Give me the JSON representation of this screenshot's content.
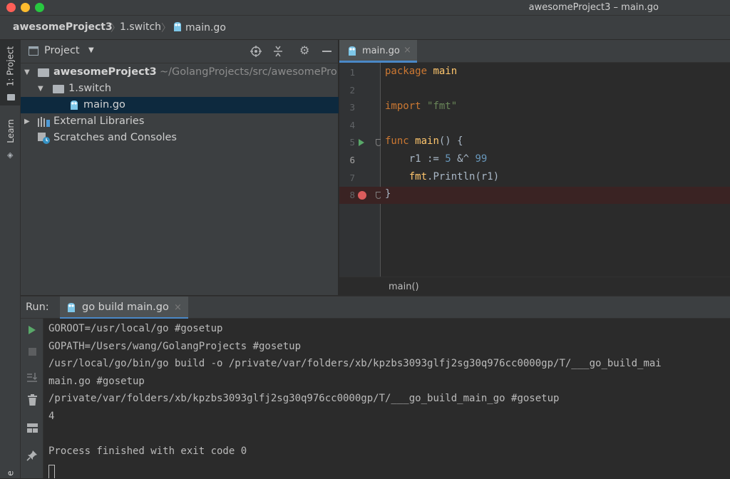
{
  "window": {
    "title": "awesomeProject3 – main.go"
  },
  "colors": {
    "close": "#ff5f57",
    "minimize": "#febc2e",
    "zoom": "#28c840",
    "selection": "#0d293e",
    "breakpoint_line": "#3a2323"
  },
  "breadcrumb": {
    "project": "awesomeProject3",
    "folder": "1.switch",
    "file": "main.go"
  },
  "left_stripe": {
    "project_tab": "1: Project",
    "learn_tab": "Learn",
    "bottom_tab": "e"
  },
  "project_panel": {
    "title": "Project",
    "tree": {
      "root_name": "awesomeProject3",
      "root_path": "~/GolangProjects/src/awesomePro",
      "folder": "1.switch",
      "file": "main.go",
      "external": "External Libraries",
      "scratches": "Scratches and Consoles"
    }
  },
  "editor": {
    "tab": "main.go",
    "lines": [
      {
        "num": "1",
        "parts": [
          {
            "t": "package ",
            "c": "kw"
          },
          {
            "t": "main",
            "c": "fn"
          }
        ]
      },
      {
        "num": "2",
        "parts": []
      },
      {
        "num": "3",
        "parts": [
          {
            "t": "import ",
            "c": "kw"
          },
          {
            "t": "\"fmt\"",
            "c": "str"
          }
        ]
      },
      {
        "num": "4",
        "parts": []
      },
      {
        "num": "5",
        "parts": [
          {
            "t": "func ",
            "c": "kw"
          },
          {
            "t": "main",
            "c": "fn"
          },
          {
            "t": "() {",
            "c": ""
          }
        ]
      },
      {
        "num": "6",
        "parts": [
          {
            "t": "    r1 := ",
            "c": ""
          },
          {
            "t": "5",
            "c": "num"
          },
          {
            "t": " &^ ",
            "c": ""
          },
          {
            "t": "99",
            "c": "num"
          }
        ]
      },
      {
        "num": "7",
        "parts": [
          {
            "t": "    ",
            "c": ""
          },
          {
            "t": "fmt",
            "c": "fn"
          },
          {
            "t": ".Println(r1)",
            "c": ""
          }
        ]
      },
      {
        "num": "8",
        "parts": [
          {
            "t": "}",
            "c": ""
          }
        ]
      }
    ],
    "breadcrumb": "main()"
  },
  "run_panel": {
    "label": "Run:",
    "tab": "go build main.go",
    "output": [
      "GOROOT=/usr/local/go #gosetup",
      "GOPATH=/Users/wang/GolangProjects #gosetup",
      "/usr/local/go/bin/go build -o /private/var/folders/xb/kpzbs3093glfj2sg30q976cc0000gp/T/___go_build_mai",
      "main.go #gosetup",
      "/private/var/folders/xb/kpzbs3093glfj2sg30q976cc0000gp/T/___go_build_main_go #gosetup",
      "4",
      "",
      "Process finished with exit code 0"
    ]
  }
}
